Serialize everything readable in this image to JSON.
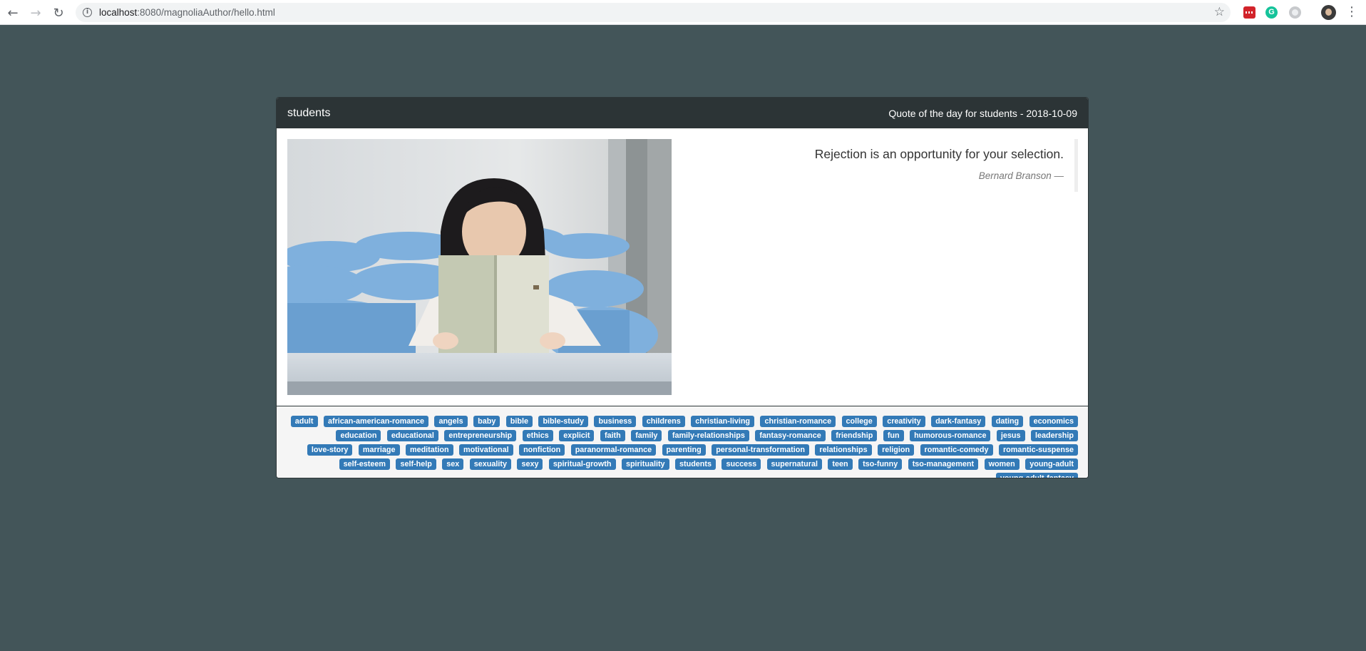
{
  "browser": {
    "url_host": "localhost",
    "url_path": ":8080/magnoliaAuthor/hello.html",
    "back_icon": "arrow-left-icon",
    "forward_icon": "arrow-right-icon",
    "reload_icon": "reload-icon",
    "info_icon": "info-icon",
    "bookmark_icon": "star-icon",
    "menu_icon": "kebab-menu-icon"
  },
  "panel": {
    "title": "students",
    "subtitle": "Quote of the day for students - 2018-10-09"
  },
  "quote": {
    "text": "Rejection is an opportunity for your selection.",
    "author": "Bernard Branson —"
  },
  "tags": [
    "adult",
    "african-american-romance",
    "angels",
    "baby",
    "bible",
    "bible-study",
    "business",
    "childrens",
    "christian-living",
    "christian-romance",
    "college",
    "creativity",
    "dark-fantasy",
    "dating",
    "economics",
    "education",
    "educational",
    "entrepreneurship",
    "ethics",
    "explicit",
    "faith",
    "family",
    "family-relationships",
    "fantasy-romance",
    "friendship",
    "fun",
    "humorous-romance",
    "jesus",
    "leadership",
    "love-story",
    "marriage",
    "meditation",
    "motivational",
    "nonfiction",
    "paranormal-romance",
    "parenting",
    "personal-transformation",
    "relationships",
    "religion",
    "romantic-comedy",
    "romantic-suspense",
    "self-esteem",
    "self-help",
    "sex",
    "sexuality",
    "sexy",
    "spiritual-growth",
    "spirituality",
    "students",
    "success",
    "supernatural",
    "teen",
    "tso-funny",
    "tso-management",
    "women",
    "young-adult",
    "young-adult-fantasy"
  ],
  "colors": {
    "page_background": "#435559",
    "panel_heading": "#2c3436",
    "tag_background": "#337ab7"
  }
}
